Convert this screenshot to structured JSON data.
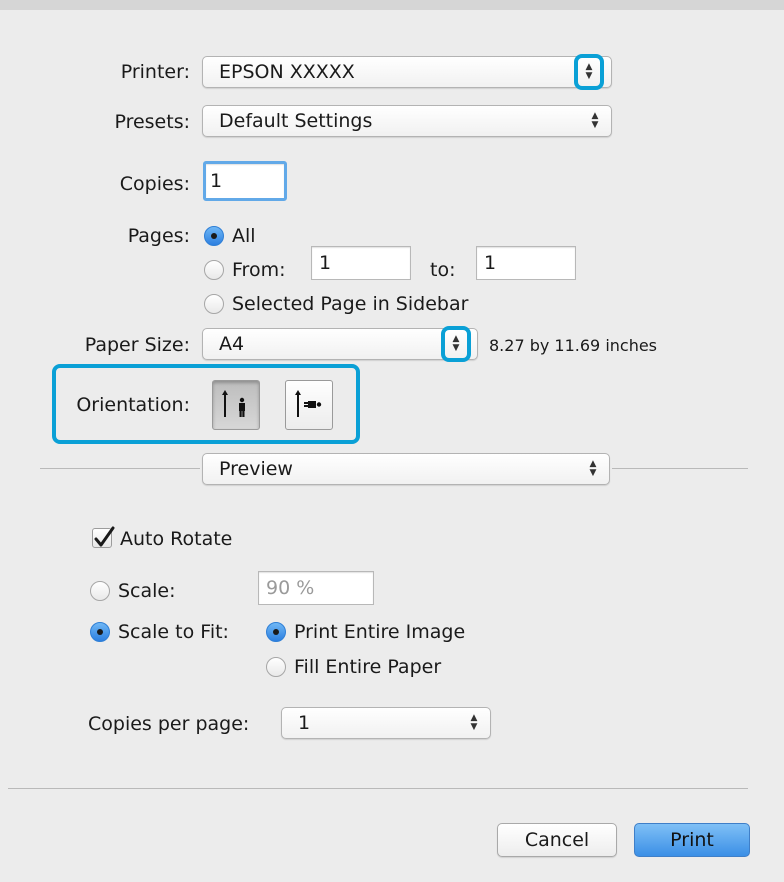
{
  "printer": {
    "label": "Printer:",
    "value": "EPSON XXXXX"
  },
  "presets": {
    "label": "Presets:",
    "value": "Default Settings"
  },
  "copies": {
    "label": "Copies:",
    "value": "1"
  },
  "pages": {
    "label": "Pages:",
    "all_label": "All",
    "from_label": "From:",
    "from_value": "1",
    "to_label": "to:",
    "to_value": "1",
    "sidebar_label": "Selected Page in Sidebar",
    "selected": "All"
  },
  "paper_size": {
    "label": "Paper Size:",
    "value": "A4",
    "dimensions": "8.27 by 11.69 inches"
  },
  "orientation": {
    "label": "Orientation:",
    "selected": "portrait"
  },
  "section_popup": {
    "value": "Preview"
  },
  "preview": {
    "auto_rotate_label": "Auto Rotate",
    "auto_rotate_checked": true,
    "scale_label": "Scale:",
    "scale_value": "90 %",
    "scale_to_fit_label": "Scale to Fit:",
    "print_entire_image_label": "Print Entire Image",
    "fill_entire_paper_label": "Fill Entire Paper",
    "scale_mode": "Scale to Fit",
    "fit_mode": "Print Entire Image",
    "copies_per_page_label": "Copies per page:",
    "copies_per_page_value": "1"
  },
  "buttons": {
    "cancel": "Cancel",
    "print": "Print"
  },
  "colors": {
    "highlight": "#0aa0d6",
    "focus_ring": "#62a9e8",
    "print_button": "#3b8fe6"
  }
}
